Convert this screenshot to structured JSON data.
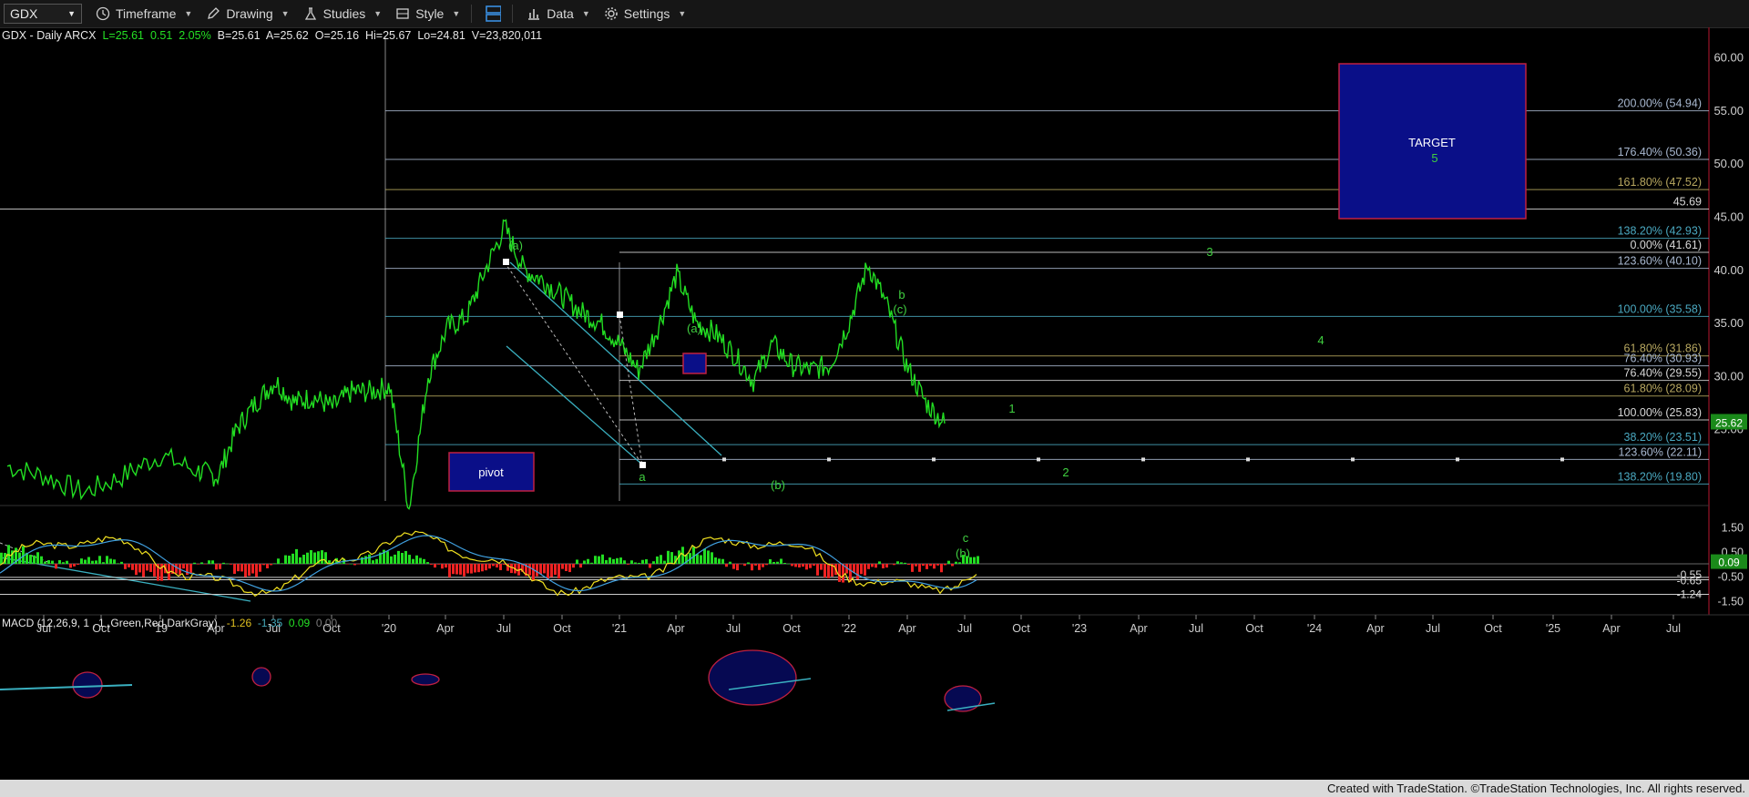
{
  "toolbar": {
    "symbol": "GDX",
    "timeframe": "Timeframe",
    "drawing": "Drawing",
    "studies": "Studies",
    "style": "Style",
    "data": "Data",
    "settings": "Settings"
  },
  "quote": {
    "name": "GDX - Daily  ARCX",
    "last": "L=25.61",
    "change": "0.51",
    "change_pct": "2.05%",
    "bid": "B=25.61",
    "ask": "A=25.62",
    "open": "O=25.16",
    "high": "Hi=25.67",
    "low": "Lo=24.81",
    "volume": "V=23,820,011"
  },
  "macd_label": {
    "name": "MACD (12,26,9, 1 , 1 ,Green,Red,DarkGray)",
    "v1": "-1.26",
    "v2": "-1.35",
    "v3": "0.09",
    "v4": "0.00"
  },
  "footer": "Created with TradeStation. ©TradeStation Technologies, Inc. All rights reserved.",
  "chart_data": {
    "type": "line",
    "series": [
      {
        "x": [
          "2018-06",
          "2018-08",
          "2018-10",
          "2018-12",
          "2019-02",
          "2019-04",
          "2019-05",
          "2019-06",
          "2019-07",
          "2019-08",
          "2019-09",
          "2019-10",
          "2019-11",
          "2019-12",
          "2020-01",
          "2020-02",
          "2020-03",
          "2020-04",
          "2020-05",
          "2020-06",
          "2020-07",
          "2020-08",
          "2020-09",
          "2020-10",
          "2020-11",
          "2020-12",
          "2021-01",
          "2021-02",
          "2021-03",
          "2021-04",
          "2021-05",
          "2021-06",
          "2021-07",
          "2021-08",
          "2021-09",
          "2021-10",
          "2021-11",
          "2021-12",
          "2022-01",
          "2022-02",
          "2022-03",
          "2022-04",
          "2022-05",
          "2022-06",
          "2022-07"
        ],
        "y": [
          21.5,
          20.5,
          19.0,
          20.5,
          22.5,
          21.0,
          20.5,
          25.0,
          27.5,
          29.5,
          27.5,
          28.0,
          27.0,
          28.5,
          28.5,
          29.0,
          17.5,
          30.0,
          34.5,
          35.5,
          40.0,
          44.0,
          40.0,
          39.0,
          37.5,
          36.0,
          35.0,
          33.0,
          30.5,
          34.5,
          39.5,
          35.0,
          34.0,
          32.0,
          29.5,
          33.0,
          31.0,
          30.5,
          31.0,
          35.0,
          40.5,
          36.5,
          31.0,
          27.5,
          25.5
        ]
      }
    ],
    "x_ticks": [
      "Jul",
      "Oct",
      "'19",
      "Apr",
      "Jul",
      "Oct",
      "'20",
      "Apr",
      "Jul",
      "Oct",
      "'21",
      "Apr",
      "Jul",
      "Oct",
      "'22",
      "Apr",
      "Jul",
      "Oct",
      "'23",
      "Apr",
      "Jul",
      "Oct",
      "'24",
      "Apr",
      "Jul",
      "Oct",
      "'25",
      "Apr",
      "Jul"
    ],
    "y_ticks": [
      "60.00",
      "55.00",
      "50.00",
      "45.00",
      "40.00",
      "35.00",
      "30.00",
      "25.00"
    ],
    "ylim": [
      18.2,
      62.8
    ],
    "last_price": "25.62",
    "fib_levels": [
      {
        "label": "200.00% (54.94)",
        "value": 54.94,
        "color": "#a8b8d0"
      },
      {
        "label": "176.40% (50.36)",
        "value": 50.36,
        "color": "#a8b8d0"
      },
      {
        "label": "161.80% (47.52)",
        "value": 47.52,
        "color": "#b8a860"
      },
      {
        "label": "45.69",
        "value": 45.69,
        "color": "#d8d8d8"
      },
      {
        "label": "138.20% (42.93)",
        "value": 42.93,
        "color": "#4aa8c0"
      },
      {
        "label": "0.00% (41.61)",
        "value": 41.61,
        "color": "#d8d8d8"
      },
      {
        "label": "123.60% (40.10)",
        "value": 40.1,
        "color": "#a8b8d0"
      },
      {
        "label": "100.00% (35.58)",
        "value": 35.58,
        "color": "#4aa8c0"
      },
      {
        "label": "61.80% (31.86)",
        "value": 31.86,
        "color": "#b8a860"
      },
      {
        "label": "76.40% (30.93)",
        "value": 30.93,
        "color": "#a8b8d0"
      },
      {
        "label": "76.40% (29.55)",
        "value": 29.55,
        "color": "#d8d8d8"
      },
      {
        "label": "61.80% (28.09)",
        "value": 28.09,
        "color": "#b8a860"
      },
      {
        "label": "100.00% (25.83)",
        "value": 25.83,
        "color": "#d8d8d8"
      },
      {
        "label": "38.20% (23.51)",
        "value": 23.51,
        "color": "#4aa8c0"
      },
      {
        "label": "123.60% (22.11)",
        "value": 22.11,
        "color": "#a8b8d0"
      },
      {
        "label": "138.20% (19.80)",
        "value": 19.8,
        "color": "#4aa8c0"
      }
    ],
    "wave_labels": [
      "(a)",
      "(a)",
      "a",
      "(b)",
      "(c)",
      "b",
      "c",
      "(b)",
      "1",
      "2",
      "3",
      "4",
      "5"
    ],
    "boxes": {
      "pivot": "pivot",
      "target": "TARGET"
    },
    "macd": {
      "y_ticks": [
        "1.50",
        "0.50",
        "-0.50",
        "-1.50"
      ],
      "ylim": [
        -2.0,
        2.0
      ],
      "markers": [
        "-0.55",
        "-0.65",
        "0.09",
        "-1.24"
      ]
    }
  },
  "colors": {
    "price": "#22dd22",
    "macd_pos": "#22dd22",
    "macd_neg": "#ee2222",
    "macd_line": "#f0e020",
    "signal_line": "#40a0e0",
    "box_fill": "#0a0f88",
    "box_border": "#c02040",
    "axis": "#cfcfcf",
    "wave_label": "#40d040"
  }
}
